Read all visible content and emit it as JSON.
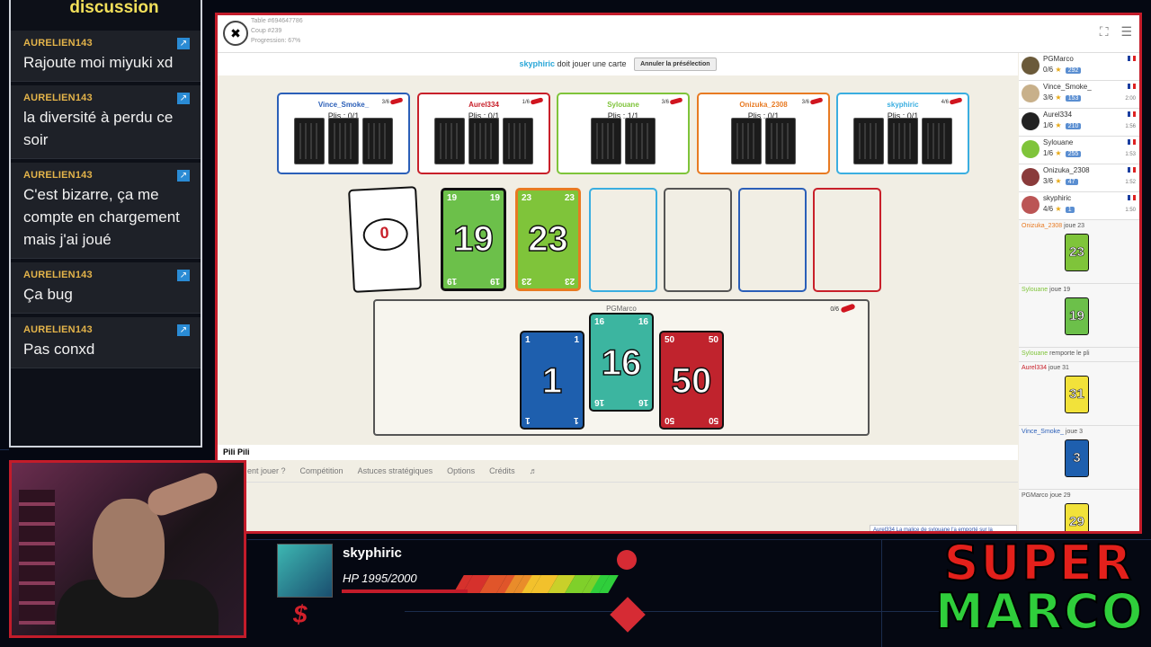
{
  "colors": {
    "accent_red": "#c31c2a",
    "chat_author": "#e4b44a",
    "title_yellow": "#f2e05a"
  },
  "chat": {
    "title": "discussion",
    "messages": [
      {
        "author": "AURELIEN143",
        "text": "Rajoute moi miyuki xd"
      },
      {
        "author": "AURELIEN143",
        "text": "la diversité à perdu ce soir"
      },
      {
        "author": "AURELIEN143",
        "text": "C'est bizarre, ça me compte en chargement mais j'ai joué"
      },
      {
        "author": "AURELIEN143",
        "text": "Ça bug"
      },
      {
        "author": "AURELIEN143",
        "text": "Pas conxd"
      }
    ]
  },
  "game": {
    "meta": {
      "table": "Table #694647786",
      "coup": "Coup #239",
      "progression": "Progression: 67%"
    },
    "status": {
      "player": "skyphiric",
      "message": "doit jouer une carte",
      "cancel_label": "Annuler la présélection"
    },
    "players": [
      {
        "name": "Vince_Smoke_",
        "plis": "Plis : 0/1",
        "chili": "3/6",
        "color": "#2b5fb8",
        "cards": 3
      },
      {
        "name": "Aurel334",
        "plis": "Plis : 0/1",
        "chili": "1/6",
        "color": "#c8202a",
        "cards": 3
      },
      {
        "name": "Sylouane",
        "plis": "Plis : 1/1",
        "chili": "3/6",
        "color": "#7fc43a",
        "cards": 2
      },
      {
        "name": "Onizuka_2308",
        "plis": "Plis : 0/1",
        "chili": "3/6",
        "color": "#e87a22",
        "cards": 2
      },
      {
        "name": "skyphiric",
        "plis": "Plis : 0/1",
        "chili": "4/6",
        "color": "#3aaee0",
        "cards": 3
      }
    ],
    "table_cards": [
      {
        "value": "0",
        "label": "zero"
      },
      {
        "value": "19",
        "color": "#6cc04a",
        "border": "#111"
      },
      {
        "value": "23",
        "color": "#7fc43a",
        "border": "#e87a22"
      }
    ],
    "hand": {
      "owner": "PGMarco",
      "chili": "0/6",
      "cards": [
        {
          "value": "1",
          "color": "#1e5fae"
        },
        {
          "value": "16",
          "color": "#3cb5a0"
        },
        {
          "value": "50",
          "color": "#c0232d"
        }
      ]
    },
    "game_name": "Pili Pili",
    "menu": [
      "ent jouer ?",
      "Compétition",
      "Astuces stratégiques",
      "Options",
      "Crédits",
      "♬"
    ],
    "ranking": [
      {
        "name": "PGMarco",
        "score": "0/6",
        "badge": "292",
        "time": ""
      },
      {
        "name": "Vince_Smoke_",
        "score": "3/6",
        "badge": "153",
        "time": "2:00"
      },
      {
        "name": "Aurel334",
        "score": "1/6",
        "badge": "210",
        "time": "1:56"
      },
      {
        "name": "Sylouane",
        "score": "1/6",
        "badge": "255",
        "time": "1:53"
      },
      {
        "name": "Onizuka_2308",
        "score": "3/6",
        "badge": "47",
        "time": "1:52"
      },
      {
        "name": "skyphiric",
        "score": "4/6",
        "badge": "1",
        "time": "1:50"
      }
    ],
    "log": [
      {
        "player": "Onizuka_2308",
        "action": "joue 23",
        "card": "23",
        "color": "#7fc43a"
      },
      {
        "player": "Sylouane",
        "action": "joue 19",
        "card": "19",
        "color": "#6cc04a"
      },
      {
        "player": "Sylouane",
        "action": "remporte le pli"
      },
      {
        "player": "Aurel334",
        "action": "joue 31",
        "card": "31",
        "color": "#f2e23a"
      },
      {
        "player": "Vince_Smoke_",
        "action": "joue 3",
        "card": "3",
        "color": "#1e5fae"
      },
      {
        "player": "PGMarco",
        "action": "joue 29",
        "card": "29",
        "color": "#f2e23a"
      }
    ],
    "toast": "Aurel334 La malice de sylouane l'a emporté sur la"
  },
  "hud": {
    "name": "skyphiric",
    "hp": "HP 1995/2000",
    "currency": "$",
    "hp_fraction": 0.9975
  },
  "brand": {
    "line1": "SUPER",
    "line2": "MARCO"
  }
}
